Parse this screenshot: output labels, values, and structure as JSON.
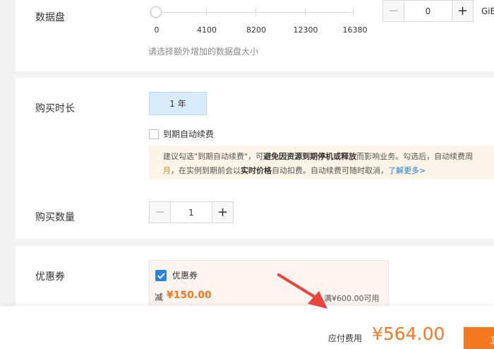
{
  "data_disk": {
    "label": "数据盘",
    "slider": {
      "value": 0,
      "ticks": [
        "0",
        "4100",
        "8200",
        "12300",
        "16380"
      ]
    },
    "stepper_value": "0",
    "unit": "GiB",
    "hint": "请选择额外增加的数据盘大小"
  },
  "duration": {
    "label": "购买时长",
    "option": "1 年",
    "auto_renew_label": "到期自动续费",
    "notice": {
      "line1_prefix": "建议勾选\"到期自动续费\"，可",
      "line1_bold": "避免因资源到期停机或释放",
      "line1_suffix": "而影响业务。勾选后，自动续费周",
      "line2_orange": "月",
      "line2_prefix": "，在实例到期前会以",
      "line2_bold": "实时价格",
      "line2_suffix": "自动扣费。自动续费可随时取消，",
      "link": "了解更多>"
    }
  },
  "quantity": {
    "label": "购买数量",
    "value": "1"
  },
  "coupon": {
    "label": "优惠券",
    "title": "优惠券",
    "minus_label": "减",
    "amount": "¥150.00",
    "condition": "满¥600.00可用"
  },
  "payment": {
    "label": "应付费用",
    "amount": "¥564.00",
    "buy_label": "立"
  },
  "colors": {
    "accent_orange": "#f47920",
    "checkbox_blue": "#2e83d8",
    "arrow_red": "#e8453c"
  }
}
